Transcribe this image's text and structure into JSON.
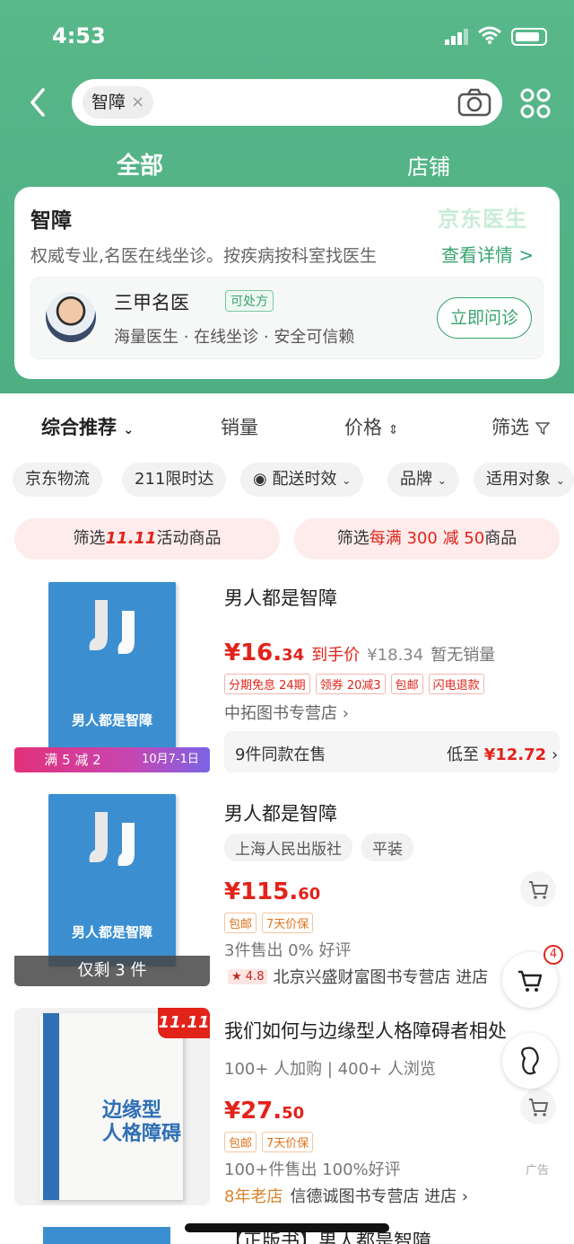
{
  "status": {
    "time": "4:53"
  },
  "search": {
    "chip": "智障",
    "chip_close": "×"
  },
  "tabs": [
    {
      "label": "全部"
    },
    {
      "label": "店铺"
    }
  ],
  "health_card": {
    "title": "智障",
    "logo": "京东医生",
    "desc": "权威专业,名医在线坐诊。按疾病按科室找医生",
    "more": "查看详情 >",
    "doctor": {
      "title": "三甲名医",
      "badge": "可处方",
      "sub": "海量医生 · 在线坐诊 · 安全可信赖",
      "button": "立即问诊"
    }
  },
  "sort": {
    "comprehensive": "综合推荐",
    "sales": "销量",
    "price": "价格",
    "filter": "筛选"
  },
  "filter_chips": [
    "京东物流",
    "211限时达",
    "配送时效",
    "品牌",
    "适用对象"
  ],
  "promo": {
    "left_prefix": "筛选",
    "left_logo": "11.11",
    "left_suffix": "活动商品",
    "right_prefix": "筛选",
    "right_mid": "每满 300 减 50",
    "right_suffix": "商品"
  },
  "products": [
    {
      "title": "男人都是智障",
      "book_text": "男人都是智障",
      "price_int": "¥16.",
      "price_dec": "34",
      "price_note": "到手价",
      "orig_price": "¥18.34",
      "sales": "暂无销量",
      "tags": [
        "分期免息 24期",
        "领券 20减3",
        "包邮",
        "闪电退款"
      ],
      "shop": "中拓图书专营店 ›",
      "banner_left": "满 5 减 2",
      "banner_right": "10月7-1日",
      "same": "9件同款在售",
      "same_low": "低至",
      "same_price": "¥12.72",
      "same_arrow": "›"
    },
    {
      "title": "男人都是智障",
      "book_text": "男人都是智障",
      "attrs": [
        "上海人民出版社",
        "平装"
      ],
      "price_int": "¥115.",
      "price_dec": "60",
      "tags": [
        "包邮",
        "7天价保"
      ],
      "sales": "3件售出  0% 好评",
      "rating": "4.8",
      "shop": "北京兴盛财富图书专营店  进店",
      "overlay": "仅剩 3 件"
    },
    {
      "title": "我们如何与边缘型人格障碍者相处",
      "book_text": "边缘型 人格障碍",
      "corner": "11.11",
      "stats": "100+ 人加购 | 400+ 人浏览",
      "price_int": "¥27.",
      "price_dec": "50",
      "tags": [
        "包邮",
        "7天价保"
      ],
      "sales": "100+件售出  100%好评",
      "ad": "广告",
      "shop_age": "8年老店",
      "shop": "信德诚图书专营店  进店 ›"
    },
    {
      "title": "【正版书】男人都是智障"
    }
  ],
  "float": {
    "cart_badge": "4"
  }
}
